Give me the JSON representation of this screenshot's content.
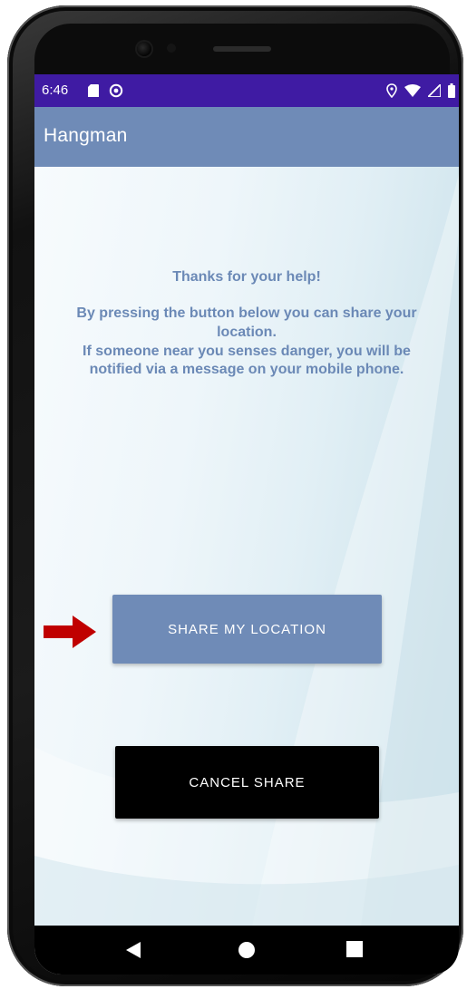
{
  "status_bar": {
    "time": "6:46",
    "left_icons": [
      "sd-card-icon",
      "circular-status-icon"
    ],
    "right_icons": [
      "location-icon",
      "wifi-icon",
      "signal-icon",
      "battery-icon"
    ],
    "color": "#3f1ba3"
  },
  "app_bar": {
    "title": "Hangman",
    "color": "#6f8bb7"
  },
  "message": {
    "title": "Thanks for your help!",
    "line1": "By pressing the button below you can share your",
    "line2": "location.",
    "line3": "If someone near you senses danger, you will be",
    "line4": "notified via a message on your mobile phone.",
    "color": "#6b89b6"
  },
  "buttons": {
    "share_label": "SHARE MY LOCATION",
    "share_color": "#6f8bb7",
    "cancel_label": "CANCEL SHARE",
    "cancel_color": "#000000"
  },
  "annotation": {
    "arrow_icon": "right-arrow-icon",
    "arrow_color": "#c00000"
  },
  "nav_bar": {
    "icons": [
      "back-icon",
      "home-icon",
      "recents-icon"
    ]
  }
}
